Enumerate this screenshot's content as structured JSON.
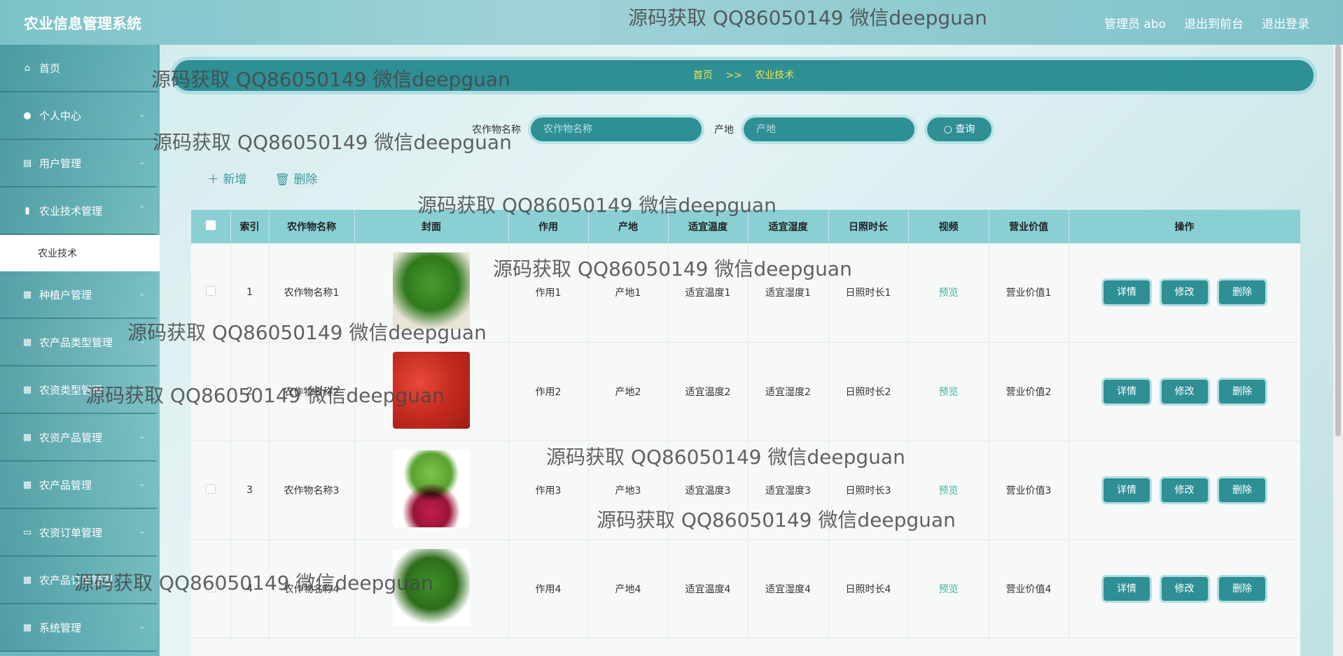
{
  "header": {
    "title": "农业信息管理系统",
    "user": "管理员 abo",
    "to_front": "退出到前台",
    "logout": "退出登录"
  },
  "sidebar": {
    "items": [
      {
        "label": "首页",
        "icon": "home-icon",
        "expandable": false
      },
      {
        "label": "个人中心",
        "icon": "user-icon",
        "expandable": true
      },
      {
        "label": "用户管理",
        "icon": "clipboard-icon",
        "expandable": true
      },
      {
        "label": "农业技术管理",
        "icon": "bar-chart-icon",
        "expandable": true
      },
      {
        "label": "种植户管理",
        "icon": "grid-icon",
        "expandable": true
      },
      {
        "label": "农产品类型管理",
        "icon": "grid-icon",
        "expandable": true
      },
      {
        "label": "农资类型管理",
        "icon": "grid-icon",
        "expandable": true
      },
      {
        "label": "农资产品管理",
        "icon": "grid-icon",
        "expandable": true
      },
      {
        "label": "农产品管理",
        "icon": "grid-icon",
        "expandable": true
      },
      {
        "label": "农资订单管理",
        "icon": "monitor-icon",
        "expandable": true
      },
      {
        "label": "农产品订单管理",
        "icon": "grid-icon",
        "expandable": true
      },
      {
        "label": "系统管理",
        "icon": "grid-icon",
        "expandable": true
      }
    ],
    "active_sub": "农业技术"
  },
  "breadcrumb": {
    "home": "首页",
    "sep": ">>",
    "current": "农业技术"
  },
  "search": {
    "label1": "农作物名称",
    "placeholder1": "农作物名称",
    "label2": "产地",
    "placeholder2": "产地",
    "button": "查询"
  },
  "actions": {
    "add": "＋ 新增",
    "delete": "删除"
  },
  "table": {
    "columns": [
      "",
      "索引",
      "农作物名称",
      "封面",
      "作用",
      "产地",
      "适宜温度",
      "适宜湿度",
      "日照时长",
      "视频",
      "营业价值",
      "操作"
    ],
    "rows": [
      {
        "index": "1",
        "name": "农作物名称1",
        "use": "作用1",
        "origin": "产地1",
        "temp": "适宜温度1",
        "humid": "适宜湿度1",
        "sun": "日照时长1",
        "video": "预览",
        "value": "营业价值1"
      },
      {
        "index": "2",
        "name": "农作物名称2",
        "use": "作用2",
        "origin": "产地2",
        "temp": "适宜温度2",
        "humid": "适宜湿度2",
        "sun": "日照时长2",
        "video": "预览",
        "value": "营业价值2"
      },
      {
        "index": "3",
        "name": "农作物名称3",
        "use": "作用3",
        "origin": "产地3",
        "temp": "适宜温度3",
        "humid": "适宜湿度3",
        "sun": "日照时长3",
        "video": "预览",
        "value": "营业价值3"
      },
      {
        "index": "4",
        "name": "农作物名称4",
        "use": "作用4",
        "origin": "产地4",
        "temp": "适宜温度4",
        "humid": "适宜湿度4",
        "sun": "日照时长4",
        "video": "预览",
        "value": "营业价值4"
      }
    ],
    "ops": {
      "detail": "详情",
      "edit": "修改",
      "remove": "删除"
    }
  },
  "watermark": "源码获取 QQ86050149 微信deepguan",
  "colors": {
    "primary": "#2e8f95",
    "header_bg": "#8acfd4",
    "accent_text": "#f5e24a",
    "preview": "#3fb6a5"
  }
}
